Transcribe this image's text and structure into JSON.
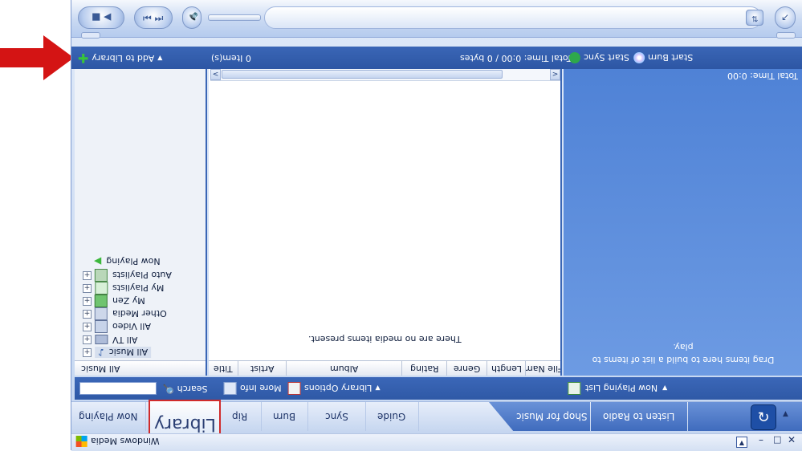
{
  "app": {
    "title": "Windows Media"
  },
  "transport": {
    "play_icon": "play-icon",
    "stop_icon": "stop-icon",
    "prev_icon": "previous-icon",
    "next_icon": "next-icon",
    "mute_icon": "speaker-icon",
    "shuffle_icon": "shuffle-icon",
    "switch_icon": "switch-to-skin-icon"
  },
  "header": {
    "add_to_library": "Add to Library",
    "items_count": "0 Item(s)",
    "total_time": "Total Time: 0:00 / 0 bytes",
    "start_sync": "Start Sync",
    "start_burn": "Start Burn"
  },
  "right_pane": {
    "total_time": "Total Time: 0:00",
    "hint_line1": "Drag items here to build a list of items to",
    "hint_line2": "play."
  },
  "library_tree": [
    {
      "label": "Now Playing",
      "icon": "now-playing-icon",
      "expander": false
    },
    {
      "label": "Auto Playlists",
      "icon": "auto-playlist-icon",
      "expander": true
    },
    {
      "label": "My Playlists",
      "icon": "playlist-icon",
      "expander": true
    },
    {
      "label": "My Zen",
      "icon": "zen-device-icon",
      "expander": true
    },
    {
      "label": "Other Media",
      "icon": "other-media-icon",
      "expander": true
    },
    {
      "label": "All Video",
      "icon": "video-icon",
      "expander": true
    },
    {
      "label": "All TV",
      "icon": "tv-icon",
      "expander": true
    },
    {
      "label": "All Music",
      "icon": "music-icon",
      "expander": true
    }
  ],
  "left_footer": "All Music",
  "main": {
    "empty_message": "There are no media items present.",
    "columns": [
      "Title",
      "Artist",
      "Album",
      "Rating",
      "Genre",
      "Length",
      "File Nam"
    ]
  },
  "searchbar": {
    "search": "Search",
    "more_info": "More Info",
    "library_options": "Library Options",
    "now_playing_list": "Now Playing List"
  },
  "tabs": {
    "now_playing": "Now Playing",
    "library": "Library",
    "rip": "Rip",
    "burn": "Burn",
    "sync": "Sync",
    "guide": "Guide",
    "shop": "Shop for Music",
    "radio": "Listen to Radio"
  },
  "colors": {
    "header_blue": "#2d56a4",
    "pane_blue": "#5a8cdc",
    "highlight_red": "#d02b2b",
    "arrow_red": "#d41414"
  }
}
